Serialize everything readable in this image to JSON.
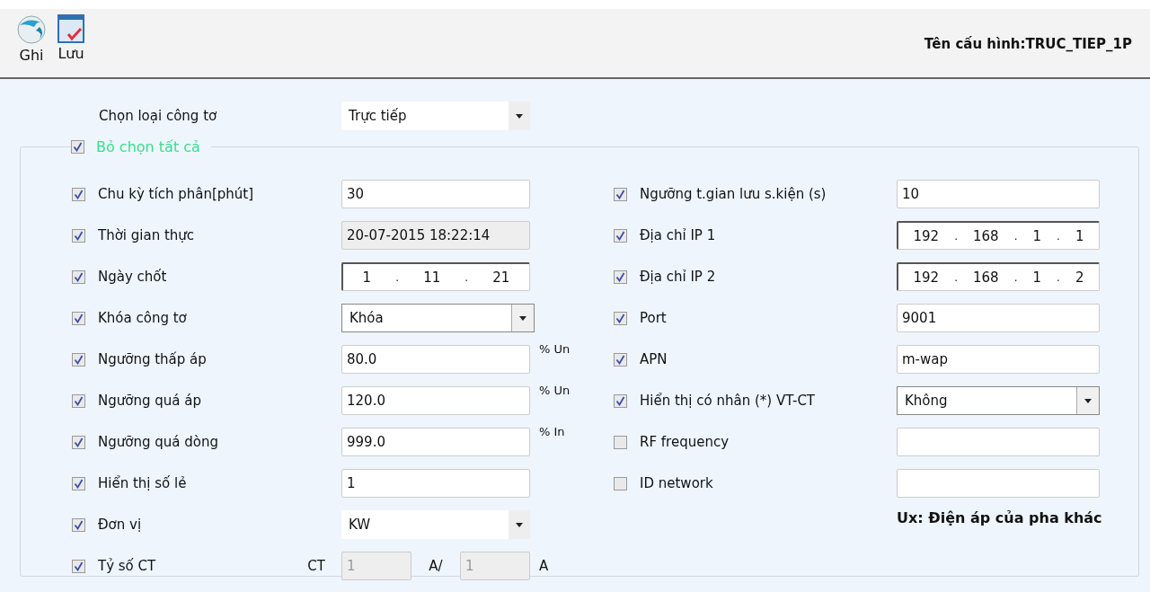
{
  "toolbar": {
    "buttons": [
      {
        "label": "Ghi",
        "kind": "sphere"
      },
      {
        "label": "Lưu",
        "kind": "window-check"
      }
    ],
    "config_name": "Tên cấu hình:TRUC_TIEP_1P"
  },
  "meter_type": {
    "label": "Chọn loại công tơ",
    "value": "Trực tiếp"
  },
  "select_all": {
    "label": "Bỏ chọn tất cả",
    "checked": true
  },
  "left_rows": [
    {
      "label": "Chu kỳ tích phân[phút]",
      "checked": true,
      "kind": "text",
      "value": "30"
    },
    {
      "label": "Thời gian thực",
      "checked": true,
      "kind": "readonly",
      "value": "20-07-2015 18:22:14"
    },
    {
      "label": "Ngày chốt",
      "checked": true,
      "kind": "segments",
      "segments": [
        "1",
        "11",
        "21"
      ],
      "separator": "."
    },
    {
      "label": "Khóa công tơ",
      "checked": true,
      "kind": "select",
      "value": "Khóa"
    },
    {
      "label": "Ngưỡng thấp áp",
      "checked": true,
      "kind": "text",
      "value": "80.0",
      "unit": "% Un"
    },
    {
      "label": "Ngưỡng quá áp",
      "checked": true,
      "kind": "text",
      "value": "120.0",
      "unit": "% Un"
    },
    {
      "label": "Ngưỡng quá dòng",
      "checked": true,
      "kind": "text",
      "value": "999.0",
      "unit": "% In"
    },
    {
      "label": "Hiển thị số lẻ",
      "checked": true,
      "kind": "text",
      "value": "1"
    },
    {
      "label": "Đơn vị",
      "checked": true,
      "kind": "flat-select",
      "value": "KW"
    },
    {
      "label": "Tỷ số CT",
      "checked": true,
      "kind": "ratio",
      "prefix": "CT",
      "value": "1",
      "middle": "A/",
      "value2": "1",
      "unit": "A"
    }
  ],
  "right_rows": [
    {
      "label": "Ngưỡng t.gian lưu s.kiện (s)",
      "checked": true,
      "kind": "text",
      "value": "10"
    },
    {
      "label": "Địa chỉ IP 1",
      "checked": true,
      "kind": "segments",
      "segments": [
        "192",
        "168",
        "1",
        "1"
      ],
      "separator": "."
    },
    {
      "label": "Địa chỉ IP 2",
      "checked": true,
      "kind": "segments",
      "segments": [
        "192",
        "168",
        "1",
        "2"
      ],
      "separator": "."
    },
    {
      "label": "Port",
      "checked": true,
      "kind": "text",
      "value": "9001"
    },
    {
      "label": "APN",
      "checked": true,
      "kind": "text",
      "value": "m-wap"
    },
    {
      "label": "Hiển thị có nhân (*) VT-CT",
      "checked": true,
      "kind": "select",
      "value": "Không"
    },
    {
      "label": "RF frequency",
      "checked": false,
      "kind": "text"
    },
    {
      "label": "ID network",
      "checked": false,
      "kind": "text"
    }
  ],
  "note": "Ux: Điện áp của pha khác"
}
